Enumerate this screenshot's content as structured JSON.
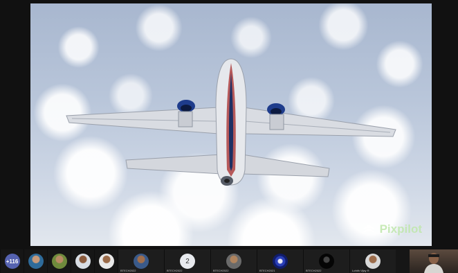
{
  "presentation": {
    "watermark_text": "Pixpilot",
    "colors": {
      "sky": "#b9c6da",
      "fuselage": "#e6e8ec",
      "stripe": "#a52a2a",
      "engine": "#1e3c8c"
    }
  },
  "participants": {
    "more_count": "+116",
    "tiles": [
      {
        "type": "photo",
        "icon": "person-photo"
      },
      {
        "type": "photo",
        "icon": "person-photo"
      },
      {
        "type": "photo",
        "icon": "person-photo"
      },
      {
        "type": "photo",
        "icon": "person-photo"
      },
      {
        "type": "photo",
        "icon": "person-photo",
        "caption": "BTECH2022"
      },
      {
        "type": "number",
        "label": "2",
        "caption": "BTECH2022"
      },
      {
        "type": "photo",
        "icon": "person-photo",
        "caption": "BTECH2022"
      },
      {
        "type": "logo",
        "icon": "emblem",
        "caption": "BTECH2021"
      },
      {
        "type": "photo",
        "icon": "dark-photo",
        "caption": "BTECH2022"
      },
      {
        "type": "photo",
        "icon": "person-photo",
        "caption": "Lohith Vijay R"
      }
    ]
  }
}
